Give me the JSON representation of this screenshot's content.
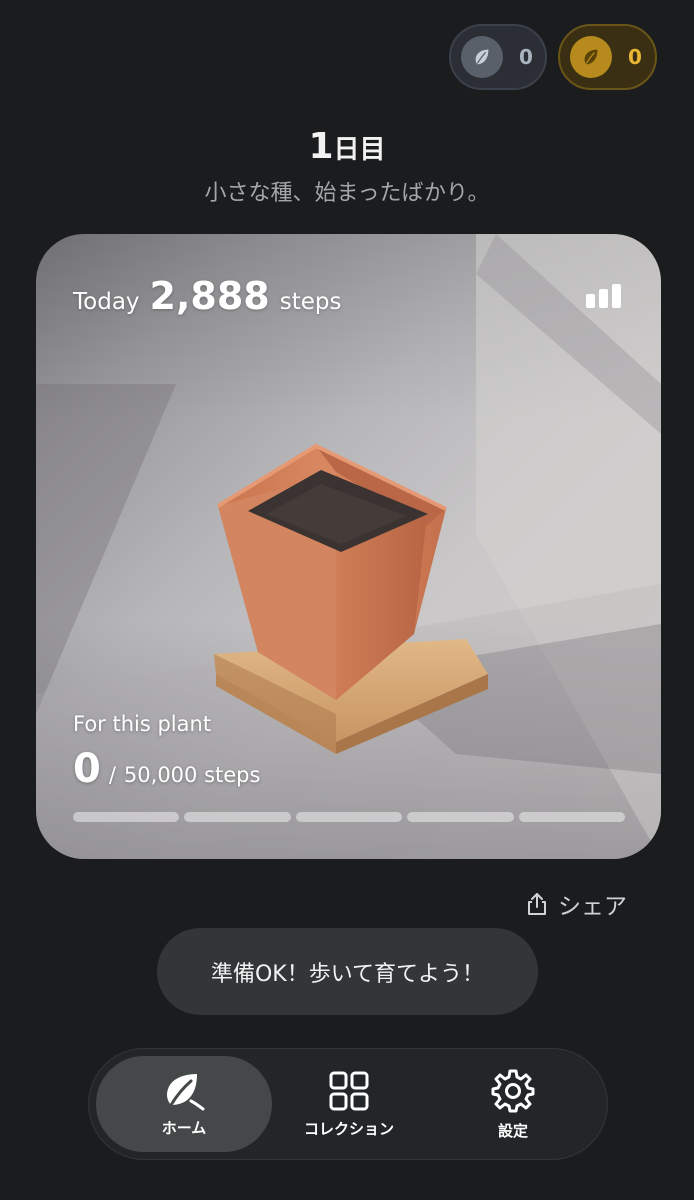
{
  "currencies": [
    {
      "name": "silver-leaf",
      "count": "0",
      "color": "#59606a"
    },
    {
      "name": "gold-leaf",
      "count": "0",
      "color": "#b68a1c"
    }
  ],
  "day": {
    "number": "1",
    "unit": "日目",
    "subtitle": "小さな種、始まったばかり。"
  },
  "card": {
    "today_label": "Today",
    "today_steps": "2,888",
    "today_unit": "steps",
    "stats_icon": "bar-chart-icon",
    "plant_label": "For this plant",
    "plant_current": "0",
    "plant_separator": "/",
    "plant_goal": "50,000 steps",
    "progress_fraction": 0,
    "segments": 5
  },
  "share": {
    "label": "シェア",
    "icon": "share-icon"
  },
  "toast": {
    "text": "準備OK！歩いて育てよう！"
  },
  "tabs": [
    {
      "label": "ホーム",
      "icon": "leaf-icon",
      "active": true
    },
    {
      "label": "コレクション",
      "icon": "grid-icon",
      "active": false
    },
    {
      "label": "設定",
      "icon": "gear-icon",
      "active": false
    }
  ]
}
